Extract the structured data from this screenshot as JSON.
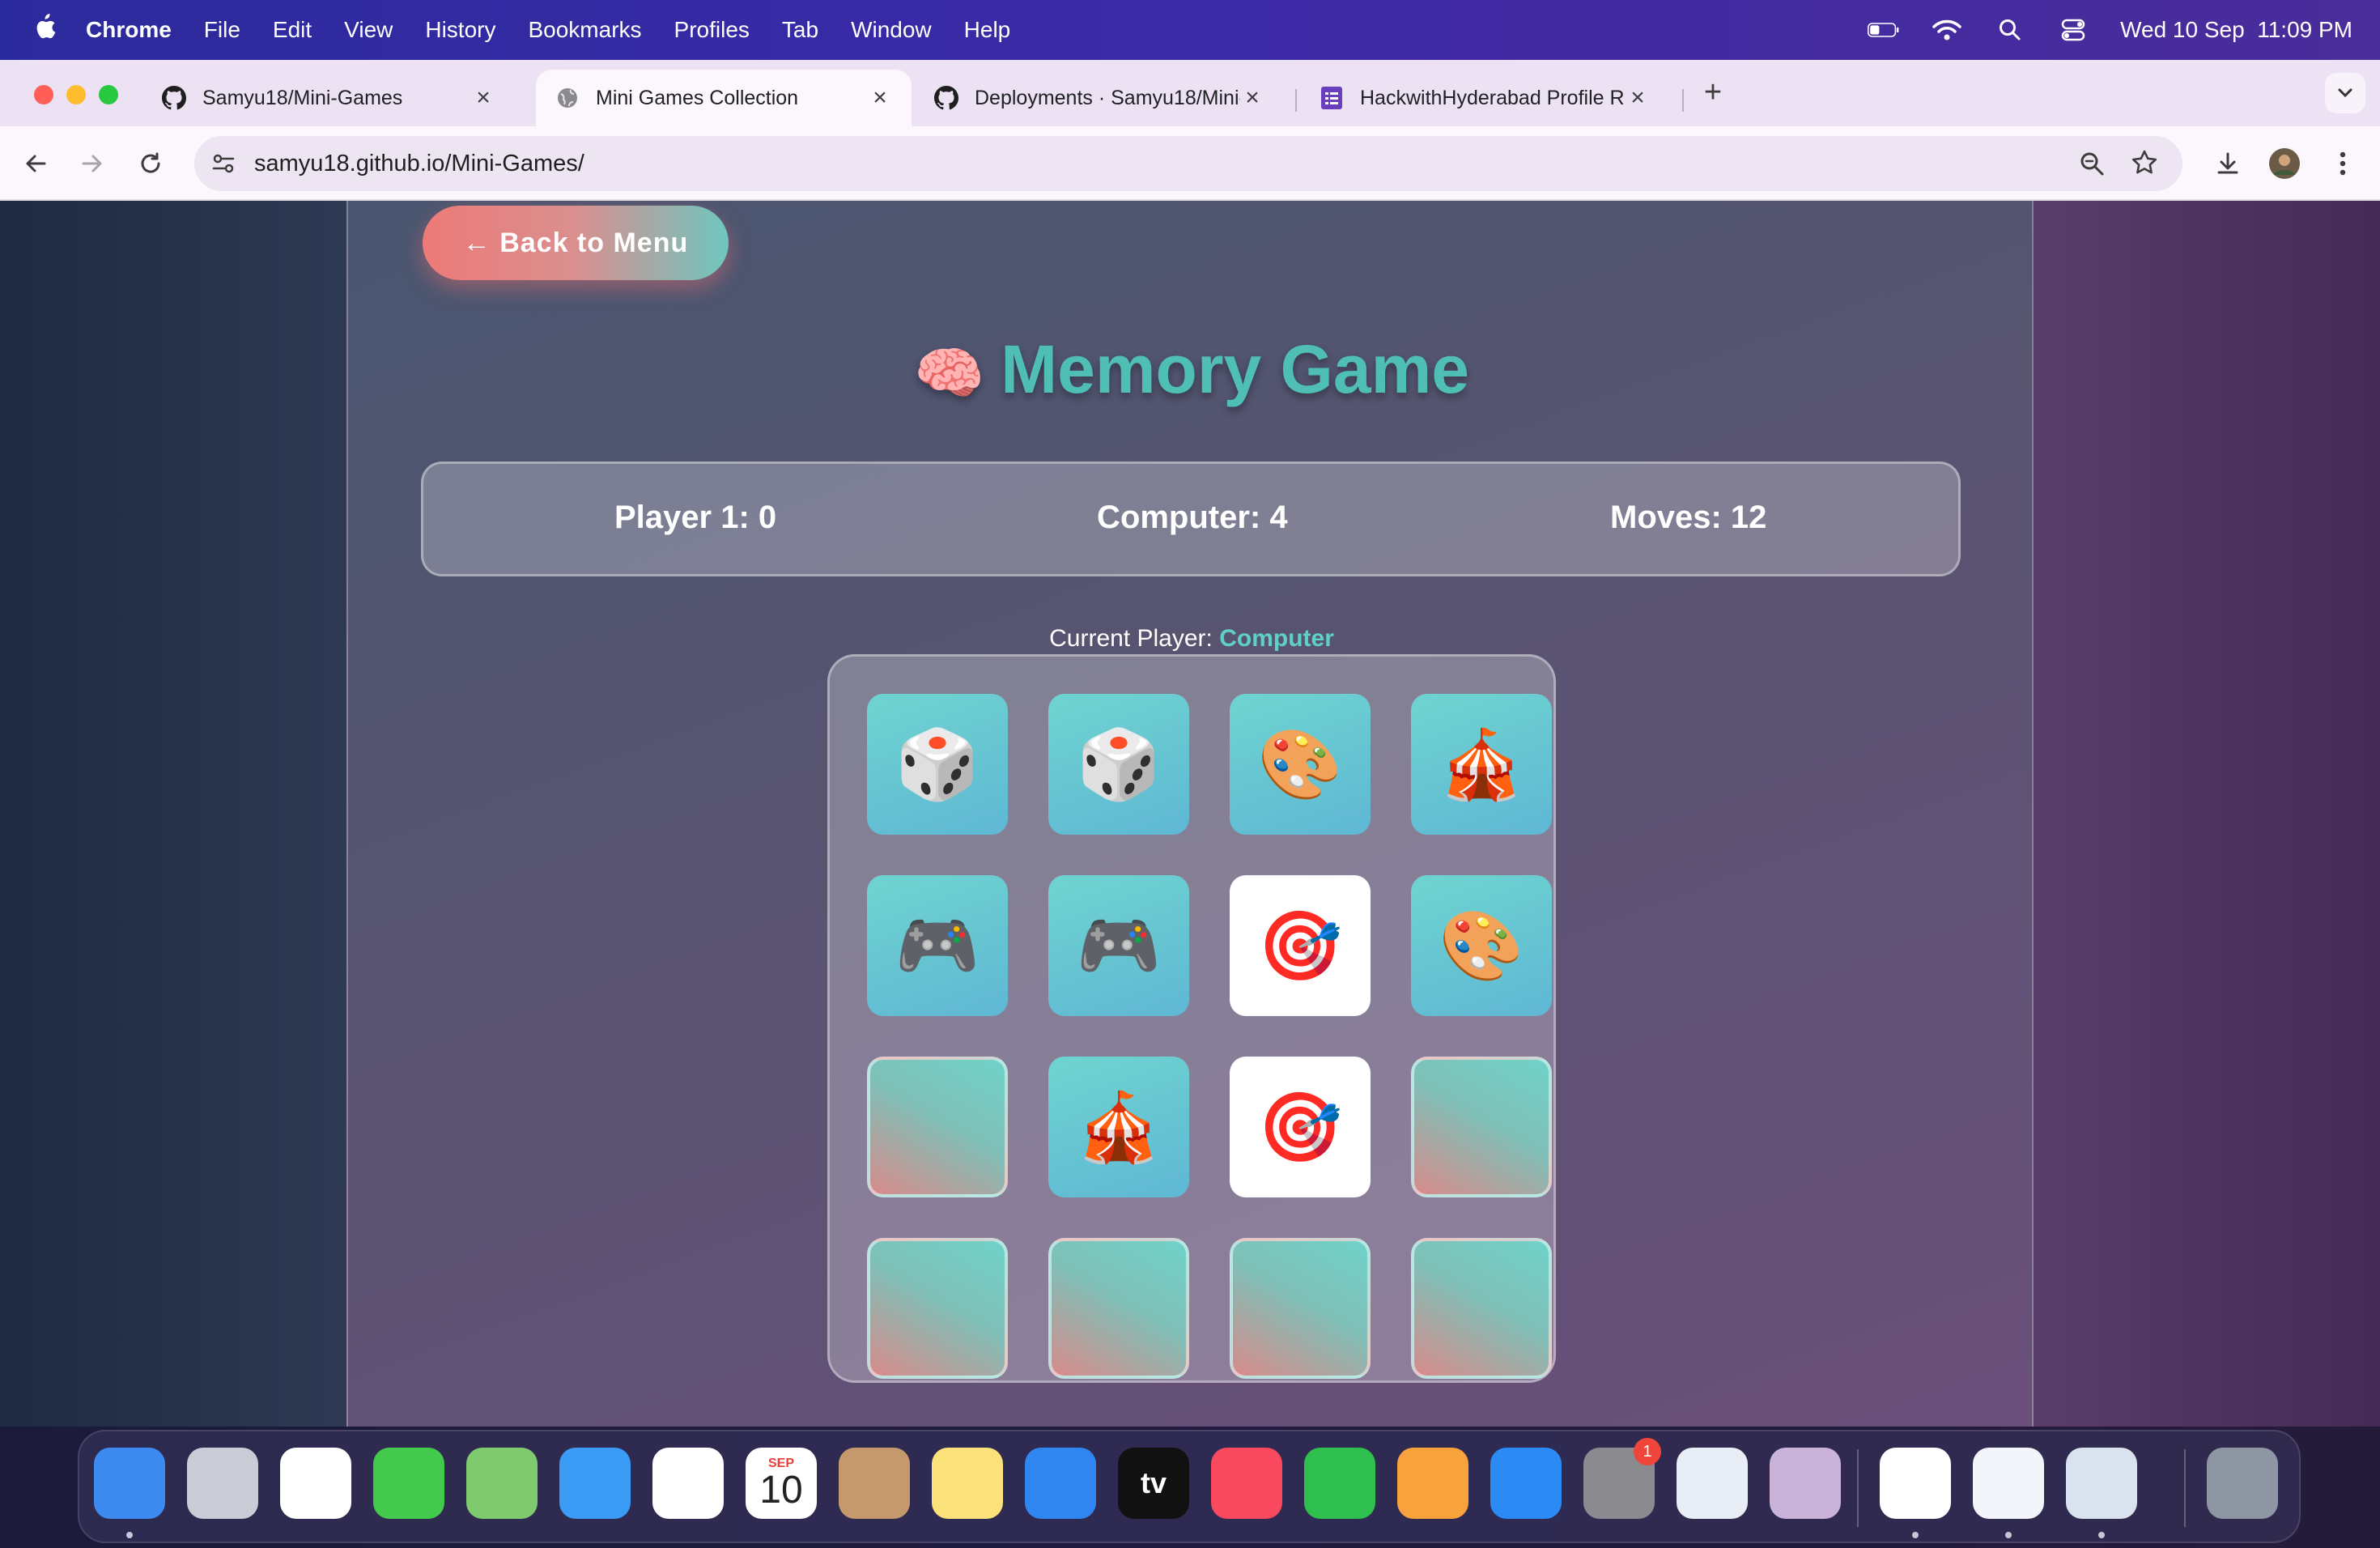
{
  "menubar": {
    "app_name": "Chrome",
    "items": [
      "File",
      "Edit",
      "View",
      "History",
      "Bookmarks",
      "Profiles",
      "Tab",
      "Window",
      "Help"
    ],
    "clock": "Wed 10 Sep  11:09 PM"
  },
  "tabs": [
    {
      "title": "Samyu18/Mini-Games",
      "icon": "github-icon",
      "active": false
    },
    {
      "title": "Mini Games Collection",
      "icon": "globe-icon",
      "active": true
    },
    {
      "title": "Deployments · Samyu18/Mini-",
      "icon": "github-icon",
      "active": false
    },
    {
      "title": "HackwithHyderabad Profile R",
      "icon": "forms-icon",
      "active": false
    }
  ],
  "address_bar": {
    "host": "samyu18.github.io",
    "path": "/Mini-Games/"
  },
  "game": {
    "back_label": "← Back to Menu",
    "brain_emoji": "🧠",
    "title": "Memory Game",
    "score_player": "Player 1: 0",
    "score_computer": "Computer: 4",
    "score_moves": "Moves: 12",
    "current_player_label": "Current Player:",
    "current_player": "Computer",
    "cards": [
      {
        "emoji": "🎲",
        "state": "matched"
      },
      {
        "emoji": "🎲",
        "state": "matched"
      },
      {
        "emoji": "🎨",
        "state": "matched"
      },
      {
        "emoji": "🎪",
        "state": "matched"
      },
      {
        "emoji": "🎮",
        "state": "matched"
      },
      {
        "emoji": "🎮",
        "state": "matched"
      },
      {
        "emoji": "🎯",
        "state": "revealed"
      },
      {
        "emoji": "🎨",
        "state": "matched"
      },
      {
        "emoji": "",
        "state": "hidden"
      },
      {
        "emoji": "🎪",
        "state": "matched"
      },
      {
        "emoji": "🎯",
        "state": "revealed"
      },
      {
        "emoji": "",
        "state": "hidden"
      },
      {
        "emoji": "",
        "state": "hidden"
      },
      {
        "emoji": "",
        "state": "hidden"
      },
      {
        "emoji": "",
        "state": "hidden"
      },
      {
        "emoji": "",
        "state": "hidden"
      }
    ]
  },
  "dock": {
    "calendar_month": "SEP",
    "calendar_day": "10",
    "settings_badge": "1",
    "tv_label": "tv",
    "apps": [
      {
        "name": "finder",
        "color": "#3d8bf0"
      },
      {
        "name": "launchpad",
        "color": "#c9cbd6"
      },
      {
        "name": "reminders",
        "color": "#ffffff"
      },
      {
        "name": "messages",
        "color": "#43c94c"
      },
      {
        "name": "maps",
        "color": "#7fc96f"
      },
      {
        "name": "mail",
        "color": "#3a9cf5"
      },
      {
        "name": "photos",
        "color": "#ffffff"
      },
      {
        "name": "calendar",
        "color": "#ffffff"
      },
      {
        "name": "contacts",
        "color": "#c49a6c"
      },
      {
        "name": "notes",
        "color": "#fbe27a"
      },
      {
        "name": "keynote",
        "color": "#2f86f0"
      },
      {
        "name": "apple-tv",
        "color": "#111111"
      },
      {
        "name": "music",
        "color": "#f8495e"
      },
      {
        "name": "numbers",
        "color": "#2fbf4e"
      },
      {
        "name": "pages",
        "color": "#f7a23a"
      },
      {
        "name": "app-store",
        "color": "#2b8af3"
      },
      {
        "name": "system-settings",
        "color": "#8b8b8f"
      },
      {
        "name": "safari",
        "color": "#e9eef6"
      },
      {
        "name": "iphone-mirroring",
        "color": "#c9b3d8"
      },
      {
        "name": "chrome",
        "color": "#ffffff"
      },
      {
        "name": "vscode",
        "color": "#f2f6fb"
      },
      {
        "name": "preview",
        "color": "#d8e3ef"
      },
      {
        "name": "trash",
        "color": "#8f96a3"
      }
    ]
  }
}
